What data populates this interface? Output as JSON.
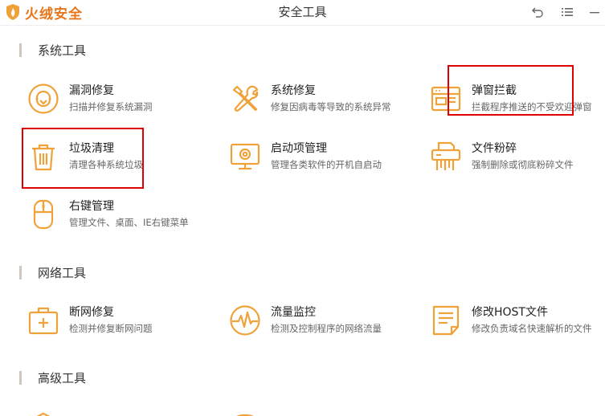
{
  "app": {
    "brand_name": "火绒安全",
    "window_title": "安全工具",
    "accent_color": "#f0a23a",
    "annotation_color": "#e00000"
  },
  "sections": [
    {
      "title": "系统工具",
      "tools": [
        {
          "name": "漏洞修复",
          "desc": "扫描并修复系统漏洞",
          "icon": "vulnerability-fix-icon"
        },
        {
          "name": "系统修复",
          "desc": "修复因病毒等导致的系统异常",
          "icon": "wrench-screwdriver-icon"
        },
        {
          "name": "弹窗拦截",
          "desc": "拦截程序推送的不受欢迎弹窗",
          "icon": "popup-window-icon"
        },
        {
          "name": "垃圾清理",
          "desc": "清理各种系统垃圾",
          "icon": "trash-can-icon"
        },
        {
          "name": "启动项管理",
          "desc": "管理各类软件的开机自启动",
          "icon": "monitor-startup-icon"
        },
        {
          "name": "文件粉碎",
          "desc": "强制删除或彻底粉碎文件",
          "icon": "shredder-icon"
        },
        {
          "name": "右键管理",
          "desc": "管理文件、桌面、IE右键菜单",
          "icon": "mouse-icon"
        }
      ]
    },
    {
      "title": "网络工具",
      "tools": [
        {
          "name": "断网修复",
          "desc": "检测并修复断网问题",
          "icon": "network-repair-kit-icon"
        },
        {
          "name": "流量监控",
          "desc": "检测及控制程序的网络流量",
          "icon": "traffic-monitor-icon"
        },
        {
          "name": "修改HOST文件",
          "desc": "修改负责域名快速解析的文件",
          "icon": "host-file-icon"
        }
      ]
    },
    {
      "title": "高级工具",
      "tools": []
    }
  ]
}
